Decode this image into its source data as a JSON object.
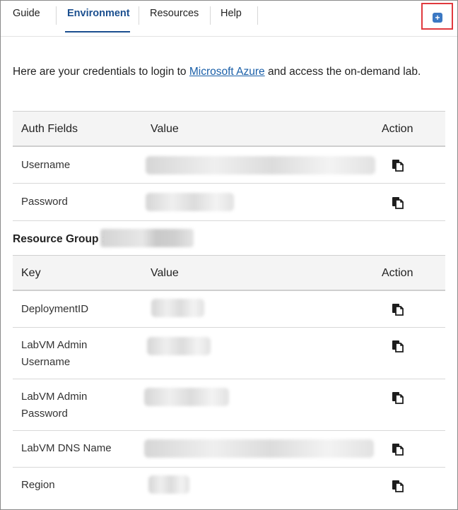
{
  "tabs": [
    {
      "label": "Guide"
    },
    {
      "label": "Environment",
      "active": true
    },
    {
      "label": "Resources"
    },
    {
      "label": "Help"
    }
  ],
  "popout": {
    "icon": "popout-icon",
    "glyph": "+"
  },
  "intro": {
    "before": "Here are your credentials to login to ",
    "link": "Microsoft Azure",
    "after": " and access the on-demand lab."
  },
  "auth_table": {
    "headers": [
      "Auth Fields",
      "Value",
      "Action"
    ],
    "rows": [
      {
        "field": "Username",
        "value": "",
        "action_icon": "copy-icon"
      },
      {
        "field": "Password",
        "value": "",
        "action_icon": "copy-icon"
      }
    ]
  },
  "resource_group": {
    "label": "Resource Group :",
    "value": ""
  },
  "resource_table": {
    "headers": [
      "Key",
      "Value",
      "Action"
    ],
    "rows": [
      {
        "key": "DeploymentID",
        "value": "",
        "action_icon": "copy-icon"
      },
      {
        "key_line1": "LabVM Admin",
        "key_line2": "Username",
        "value": "",
        "action_icon": "copy-icon"
      },
      {
        "key_line1": "LabVM Admin",
        "key_line2": "Password",
        "value": "",
        "action_icon": "copy-icon"
      },
      {
        "key": "LabVM DNS Name",
        "value": "",
        "action_icon": "copy-icon"
      },
      {
        "key": "Region",
        "value": "",
        "action_icon": "copy-icon"
      }
    ]
  },
  "colors": {
    "accent": "#1b4f8f",
    "link": "#1a5fa8",
    "highlight_box": "#e0393e",
    "icon": "#3b78c3"
  }
}
